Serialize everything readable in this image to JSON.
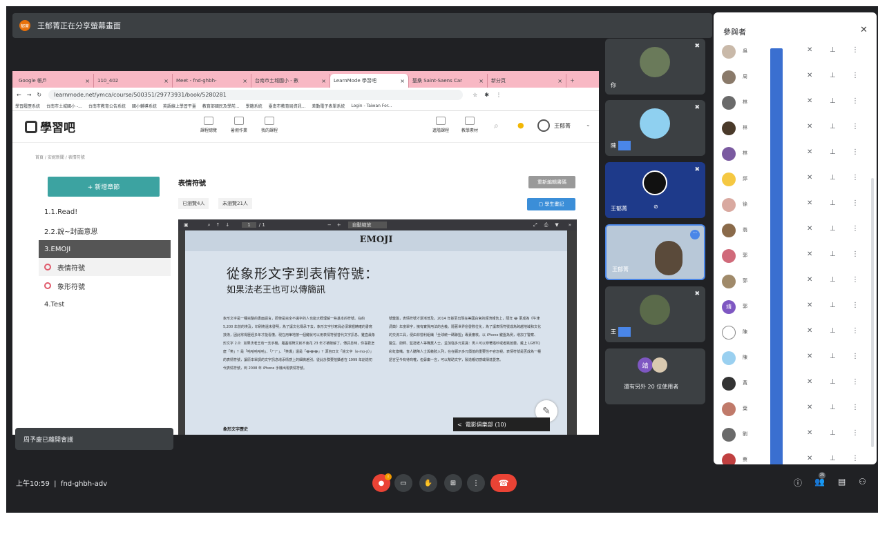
{
  "presenter_banner": {
    "avatar_text": "郁菁",
    "text": "王郁菁正在分享螢幕畫面"
  },
  "browser": {
    "tabs": [
      {
        "label": "Google 帳戶"
      },
      {
        "label": "110_402"
      },
      {
        "label": "Meet - fnd-ghbh-"
      },
      {
        "label": "台南市土城國小 - 數"
      },
      {
        "label": "LearnMode 學習吧"
      },
      {
        "label": "聖桑 Saint-Saens Car"
      },
      {
        "label": "新分頁"
      }
    ],
    "url": "learnmode.net/ymca/course/500351/29773931/book/5280281",
    "bookmarks": [
      "學習履歷系統",
      "台南市土城國小 -...",
      "台南市教育公告系統",
      "國小輔導系統",
      "英語線上學習平臺",
      "教育部國民及學前...",
      "學籍系統",
      "臺南市教育局資訊...",
      "差勤電子表單系統",
      "Login - Taiwan For..."
    ]
  },
  "lm": {
    "logo": "學習吧",
    "nav": [
      {
        "label": "課程總覽"
      },
      {
        "label": "暑假作業"
      },
      {
        "label": "我的課程"
      }
    ],
    "nav_right": [
      {
        "label": "進階課程"
      },
      {
        "label": "教學素材"
      }
    ],
    "user": "王郁菁",
    "breadcrumb": "首頁 / 安妮新聞 / 表情符號",
    "new_button": "+ 新增章節",
    "chapters": [
      {
        "label": "1.1.Read!"
      },
      {
        "label": "2.2.說~封面意思"
      },
      {
        "label": "3.EMOJI"
      },
      {
        "label": "表情符號"
      },
      {
        "label": "象形符號"
      },
      {
        "label": "4.Test"
      }
    ],
    "content_title": "表情符號",
    "reedit": "重新編輯書碼",
    "read": "已瀏覽4人",
    "unread": "未瀏覽21人",
    "student_notes": "學生畫記",
    "pdf": {
      "page": "1",
      "total": "/ 1",
      "zoom": "自動縮放"
    },
    "doc": {
      "header": "EMOJI",
      "title": "從象形文字到表情符號：",
      "subtitle": "如果法老王也可以傳簡訊",
      "col1": "象形文字是一種完整的書面語言，即使是完全不識字的人也能大概理解一些基本的符號。在約 5,200 年前的埃及，印刷術還未發明，為了讓文化傳承下去，象形文字抄寫員必須掌握精確的書寫技術，因此常得歷經多年才能看懂。現在用筆地按一個鍵就可以用表情符號替代文字訊息。雖直最象形文字 2.0：如果法老王有一支手機，羅塞塔碑文就不會花 23 年才被破解了。傳訊息時，你喜歡怎麼「笑」？是「哈哈哈哈哈」、「ㄏㄏ」、「笑爆」還是「😂😂😂」？源自日文「絵文字（e-mo-ji）」的表情符號，讓原本單調的文字訊息增添情感上的細微差別。從此計群要拍攝者在 1999 年創造初代表情符號，到 2008 年 iPhone 手機出現表情符號。",
      "col2": "號鍵盤，表情符號才逐漸普及。2014 年甚至出現在美國白宮的經濟報告上，隔年 😂 更成為《牛津詞典》年度單字，擁有實質用法的含義。隨著世界愈發數位化，為了讓表情符號成為跨越地域和文化的交流工具，便由非營利組織「全球統一碼聯盟」專責審核。以 iPhone 鍵盤為例，增加了警察、醫生、廚師、監證老人等職業人士，並加強多元意識：男人可以穿著婚紗或者跳芭蕾，戴上 LGBTQ 彩虹旗幟，盲人聽障人士與義肢入列，在在顯示多元價值的重要性不容忽視。表情符號是否成為一種語言至今有待商榷，但毋庸一言，可以幫助文字，製造親切感或傳達愛意。",
      "section": "象形文字歷史",
      "cinema": "電影俱樂部 (10)"
    }
  },
  "toast": "周予慶已離開會議",
  "tiles": [
    {
      "name": "你"
    },
    {
      "name": "陳"
    },
    {
      "name": "王郁菁"
    },
    {
      "name": "王郁菁"
    },
    {
      "name": "王"
    }
  ],
  "more": {
    "avatar": "靖",
    "text": "還有另外 20 位使用者"
  },
  "time": "上午10:59",
  "meeting_code": "fnd-ghbh-adv",
  "people_count": "25",
  "mic_badge": "!",
  "panel": {
    "title": "參與者",
    "participants": [
      {
        "name": "吳",
        "c": "#c9b9a9"
      },
      {
        "name": "周",
        "c": "#8a7a6a"
      },
      {
        "name": "林",
        "c": "#6a6a6a"
      },
      {
        "name": "林",
        "c": "#4a3a2a"
      },
      {
        "name": "林",
        "c": "#7a5aa0"
      },
      {
        "name": "邱",
        "c": "#f5c842"
      },
      {
        "name": "徐",
        "c": "#d9a9a0"
      },
      {
        "name": "翁",
        "c": "#8a6a4a"
      },
      {
        "name": "郭",
        "c": "#d06a7a"
      },
      {
        "name": "郭",
        "c": "#a08a6a"
      },
      {
        "name": "郭",
        "c": "#7e57c2",
        "t": "靖"
      },
      {
        "name": "陳",
        "c": "#ffffff"
      },
      {
        "name": "陳",
        "c": "#9ad0f0"
      },
      {
        "name": "黃",
        "c": "#333333"
      },
      {
        "name": "葉",
        "c": "#c07a6a"
      },
      {
        "name": "劉",
        "c": "#6a6a6a"
      },
      {
        "name": "蔡",
        "c": "#c04040"
      }
    ]
  }
}
